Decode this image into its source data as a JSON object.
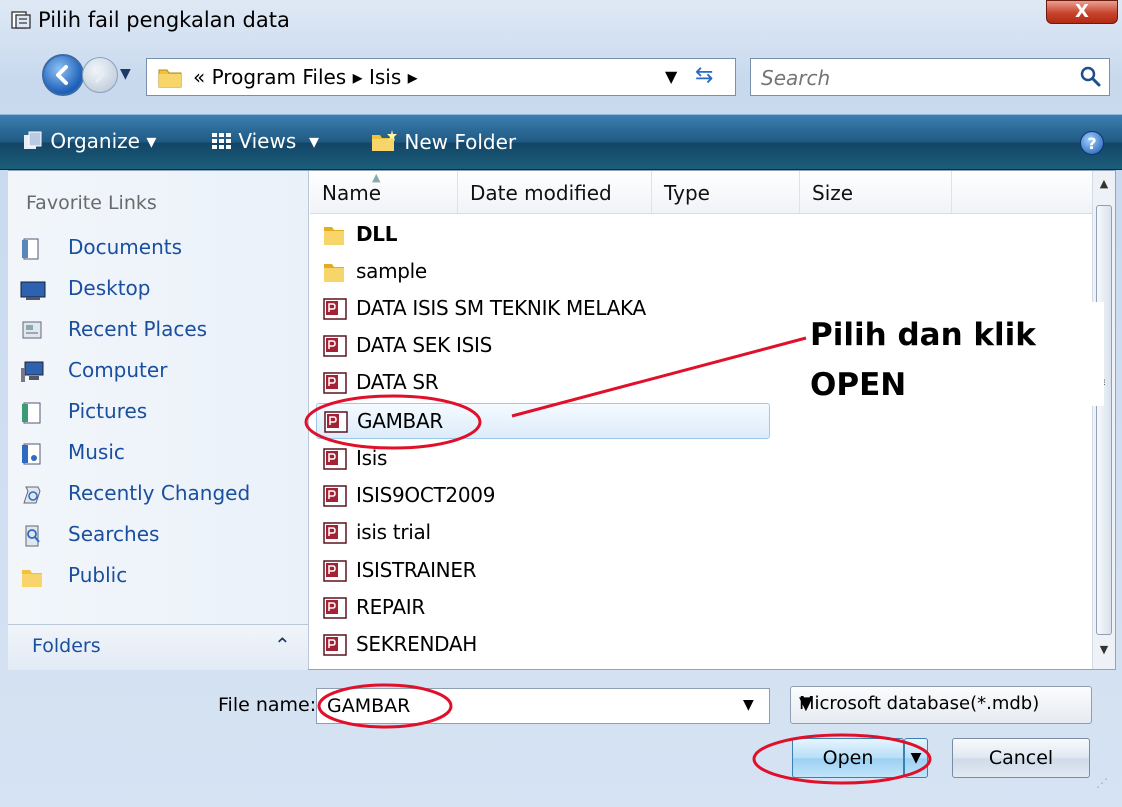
{
  "window": {
    "title": "Pilih fail pengkalan data",
    "close_label": "X"
  },
  "address": {
    "path": "« Program Files ▸ Isis ▸",
    "search_placeholder": "Search"
  },
  "toolbar": {
    "organize_label": "Organize",
    "views_label": "Views",
    "new_folder_label": "New Folder",
    "help_label": "?"
  },
  "favorites": {
    "title": "Favorite Links",
    "items": [
      {
        "label": "Documents",
        "icon": "documents-icon"
      },
      {
        "label": "Desktop",
        "icon": "desktop-icon"
      },
      {
        "label": "Recent Places",
        "icon": "recent-places-icon"
      },
      {
        "label": "Computer",
        "icon": "computer-icon"
      },
      {
        "label": "Pictures",
        "icon": "pictures-icon"
      },
      {
        "label": "Music",
        "icon": "music-icon"
      },
      {
        "label": "Recently Changed",
        "icon": "recently-changed-icon"
      },
      {
        "label": "Searches",
        "icon": "searches-icon"
      },
      {
        "label": "Public",
        "icon": "public-folder-icon"
      }
    ],
    "folders_label": "Folders"
  },
  "list": {
    "columns": [
      "Name",
      "Date modified",
      "Type",
      "Size"
    ],
    "rows": [
      {
        "name": "DLL",
        "kind": "folder"
      },
      {
        "name": "sample",
        "kind": "folder"
      },
      {
        "name": "DATA ISIS SM TEKNIK MELAKA",
        "kind": "access"
      },
      {
        "name": "DATA SEK ISIS",
        "kind": "access"
      },
      {
        "name": "DATA SR",
        "kind": "access"
      },
      {
        "name": "GAMBAR",
        "kind": "access",
        "selected": true
      },
      {
        "name": "Isis",
        "kind": "access"
      },
      {
        "name": "ISIS9OCT2009",
        "kind": "access"
      },
      {
        "name": "isis trial",
        "kind": "access"
      },
      {
        "name": "ISISTRAINER",
        "kind": "access"
      },
      {
        "name": "REPAIR",
        "kind": "access"
      },
      {
        "name": "SEKRENDAH",
        "kind": "access"
      }
    ]
  },
  "annotation": {
    "line1": "Pilih dan klik",
    "line2": "OPEN",
    "color": "#e0102a"
  },
  "bottom": {
    "file_name_label": "File name:",
    "file_name_value": "GAMBAR",
    "file_type": "Microsoft database(*.mdb)",
    "open_label": "Open",
    "cancel_label": "Cancel"
  }
}
